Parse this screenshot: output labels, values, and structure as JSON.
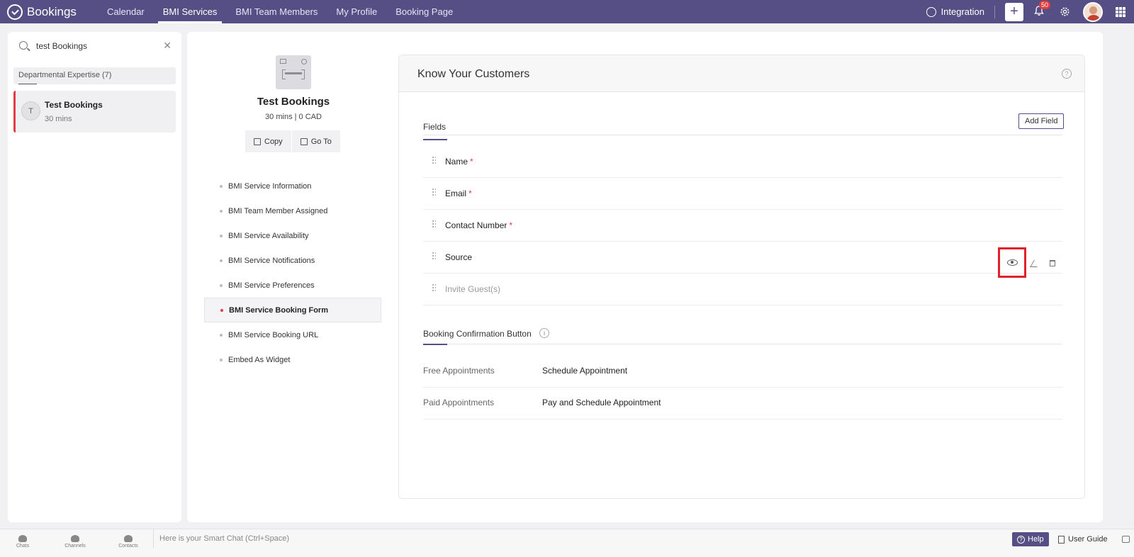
{
  "topbar": {
    "app_name": "Bookings",
    "nav": [
      "Calendar",
      "BMI Services",
      "BMI Team Members",
      "My Profile",
      "Booking Page"
    ],
    "active_nav": "BMI Services",
    "integration_label": "Integration",
    "notification_count": "50",
    "plus_label": "+"
  },
  "sidebar": {
    "search_value": "test Bookings",
    "clear_label": "✕",
    "group_label": "Departmental Expertise (7)",
    "service": {
      "initial": "T",
      "title": "Test Bookings",
      "duration": "30 mins"
    }
  },
  "service_panel": {
    "name": "Test Bookings",
    "meta": "30 mins | 0 CAD",
    "copy_label": "Copy",
    "goto_label": "Go To",
    "menu": [
      "BMI Service Information",
      "BMI Team Member Assigned",
      "BMI Service Availability",
      "BMI Service Notifications",
      "BMI Service Preferences",
      "BMI Service Booking Form",
      "BMI Service Booking URL",
      "Embed As Widget"
    ],
    "active_menu": "BMI Service Booking Form"
  },
  "kyc": {
    "title": "Know Your Customers",
    "help_icon": "?",
    "fields_tab": "Fields",
    "add_field_label": "Add Field",
    "fields": [
      {
        "name": "Name",
        "required": "*"
      },
      {
        "name": "Email",
        "required": "*"
      },
      {
        "name": "Contact Number",
        "required": "*"
      },
      {
        "name": "Source",
        "required": ""
      },
      {
        "name": "Invite Guest(s)",
        "required": ""
      }
    ],
    "confirmation_title": "Booking Confirmation Button",
    "info_icon": "i",
    "appointments": [
      {
        "key": "Free Appointments",
        "value": "Schedule Appointment"
      },
      {
        "key": "Paid Appointments",
        "value": "Pay and Schedule Appointment"
      }
    ]
  },
  "bottombar": {
    "chats": "Chats",
    "channels": "Channels",
    "contacts": "Contacts",
    "smart_chat_placeholder": "Here is your Smart Chat (Ctrl+Space)",
    "help_label": "Help",
    "user_guide_label": "User Guide"
  }
}
